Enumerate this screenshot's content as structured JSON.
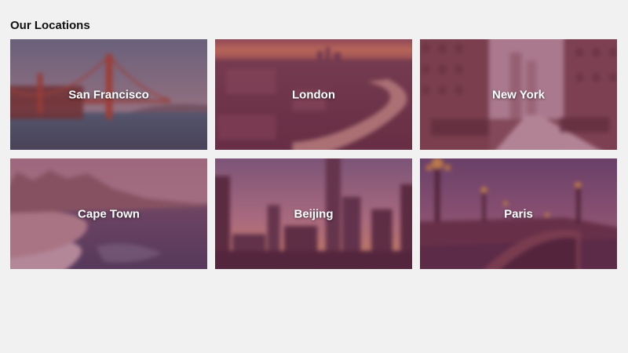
{
  "page": {
    "heading": "Our Locations"
  },
  "locations": [
    {
      "name": "San Francisco",
      "image": "golden-gate-bridge"
    },
    {
      "name": "London",
      "image": "thames-river-aerial"
    },
    {
      "name": "New York",
      "image": "city-street"
    },
    {
      "name": "Cape Town",
      "image": "table-mountain-coast"
    },
    {
      "name": "Beijing",
      "image": "skyline-dusk"
    },
    {
      "name": "Paris",
      "image": "pont-alexandre-iii"
    }
  ],
  "colors": {
    "page_background": "#f1f1f1",
    "heading_text": "#111111",
    "label_text": "#ffffff",
    "overlay_tint": "#782d50"
  }
}
